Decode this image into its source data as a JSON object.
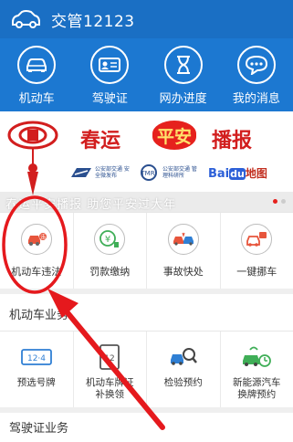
{
  "header": {
    "title": "交管12123",
    "logo_icon": "car-outline-icon"
  },
  "nav": [
    {
      "label": "机动车",
      "icon": "car-icon"
    },
    {
      "label": "驾驶证",
      "icon": "id-card-icon"
    },
    {
      "label": "网办进度",
      "icon": "hourglass-icon"
    },
    {
      "label": "我的消息",
      "icon": "chat-bubble-icon"
    }
  ],
  "banner": {
    "word_left": "春运",
    "word_center": "平安",
    "word_right": "播报",
    "caption": "春运平安播报 助您平安过大年",
    "logo1_text": "公安部交通 安全微发布",
    "logo2_text": "公安部交通 管理科研所",
    "baidu_left": "Bai",
    "baidu_du": "du",
    "baidu_map": "地图"
  },
  "quick": [
    {
      "label": "机动车违法",
      "icon": "car-violation-icon"
    },
    {
      "label": "罚款缴纳",
      "icon": "yen-coin-icon"
    },
    {
      "label": "事故快处",
      "icon": "accident-icon"
    },
    {
      "label": "一键挪车",
      "icon": "move-car-icon"
    }
  ],
  "sections": {
    "vehicle": "机动车业务",
    "license": "驾驶证业务"
  },
  "biz": [
    {
      "line1": "预选号牌",
      "line2": "",
      "icon": "plate-select-icon"
    },
    {
      "line1": "机动车牌证",
      "line2": "补换领",
      "icon": "plate-replace-icon"
    },
    {
      "line1": "检验预约",
      "line2": "",
      "icon": "inspection-icon"
    },
    {
      "line1": "新能源汽车",
      "line2": "换牌预约",
      "icon": "ev-plate-icon"
    }
  ],
  "colors": {
    "brand_blue": "#1c78d1",
    "accent_red": "#e6211d",
    "annotation_red": "#e5191d"
  }
}
